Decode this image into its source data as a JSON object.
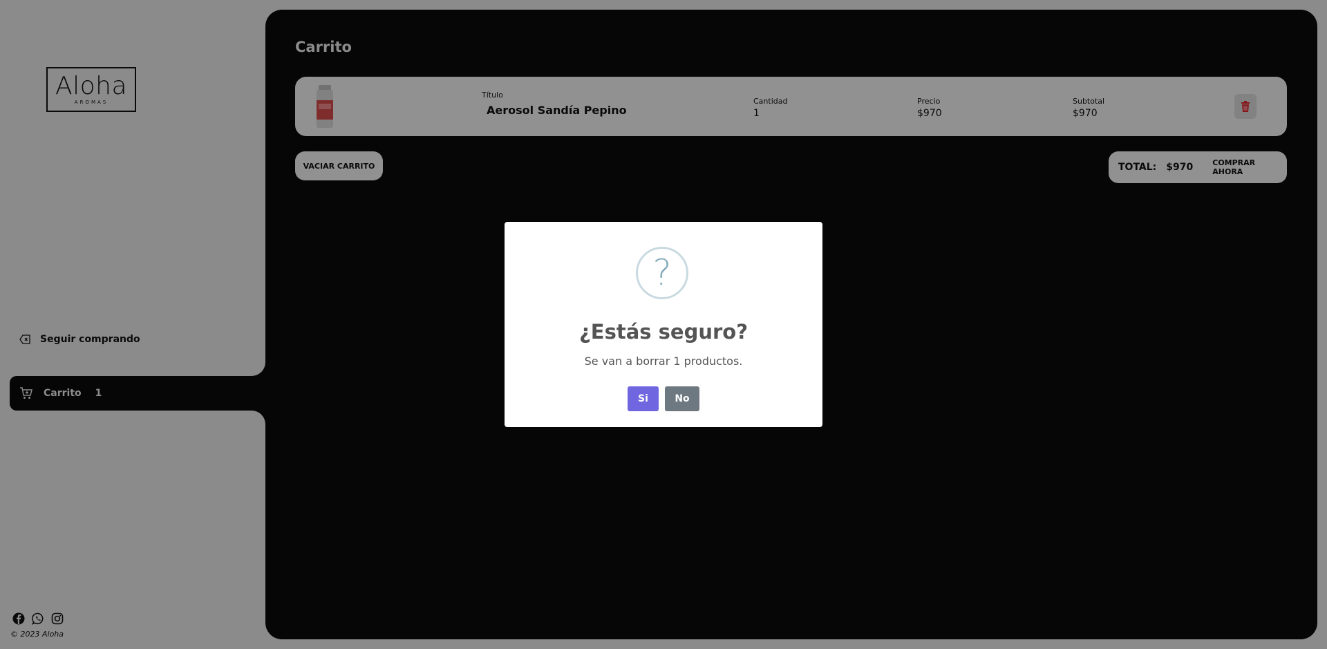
{
  "brand": {
    "name": "Aloha",
    "tagline": "AROMAS"
  },
  "sidebar": {
    "continue_label": "Seguir comprando",
    "cart_label": "Carrito",
    "cart_count": "1",
    "social_icons": [
      "facebook-icon",
      "whatsapp-icon",
      "instagram-icon"
    ],
    "copyright": "© 2023 Aloha"
  },
  "main": {
    "title": "Carrito",
    "item": {
      "title_header": "Título",
      "title": "Aerosol Sandía Pepino",
      "qty_header": "Cantidad",
      "qty": "1",
      "price_header": "Precio",
      "price": "$970",
      "subtotal_header": "Subtotal",
      "subtotal": "$970"
    },
    "empty_cart_label": "VACIAR CARRITO",
    "total_label": "TOTAL:",
    "total_value": "$970",
    "buy_label": "COMPRAR AHORA"
  },
  "modal": {
    "icon": "?",
    "title": "¿Estás seguro?",
    "text": "Se van a borrar 1 productos.",
    "confirm_label": "Si",
    "cancel_label": "No"
  },
  "colors": {
    "panel": "#0a0a0a",
    "background": "#e8e8e8",
    "confirm": "#7066e0",
    "cancel": "#6e7881",
    "delete_icon": "#e0242c"
  }
}
